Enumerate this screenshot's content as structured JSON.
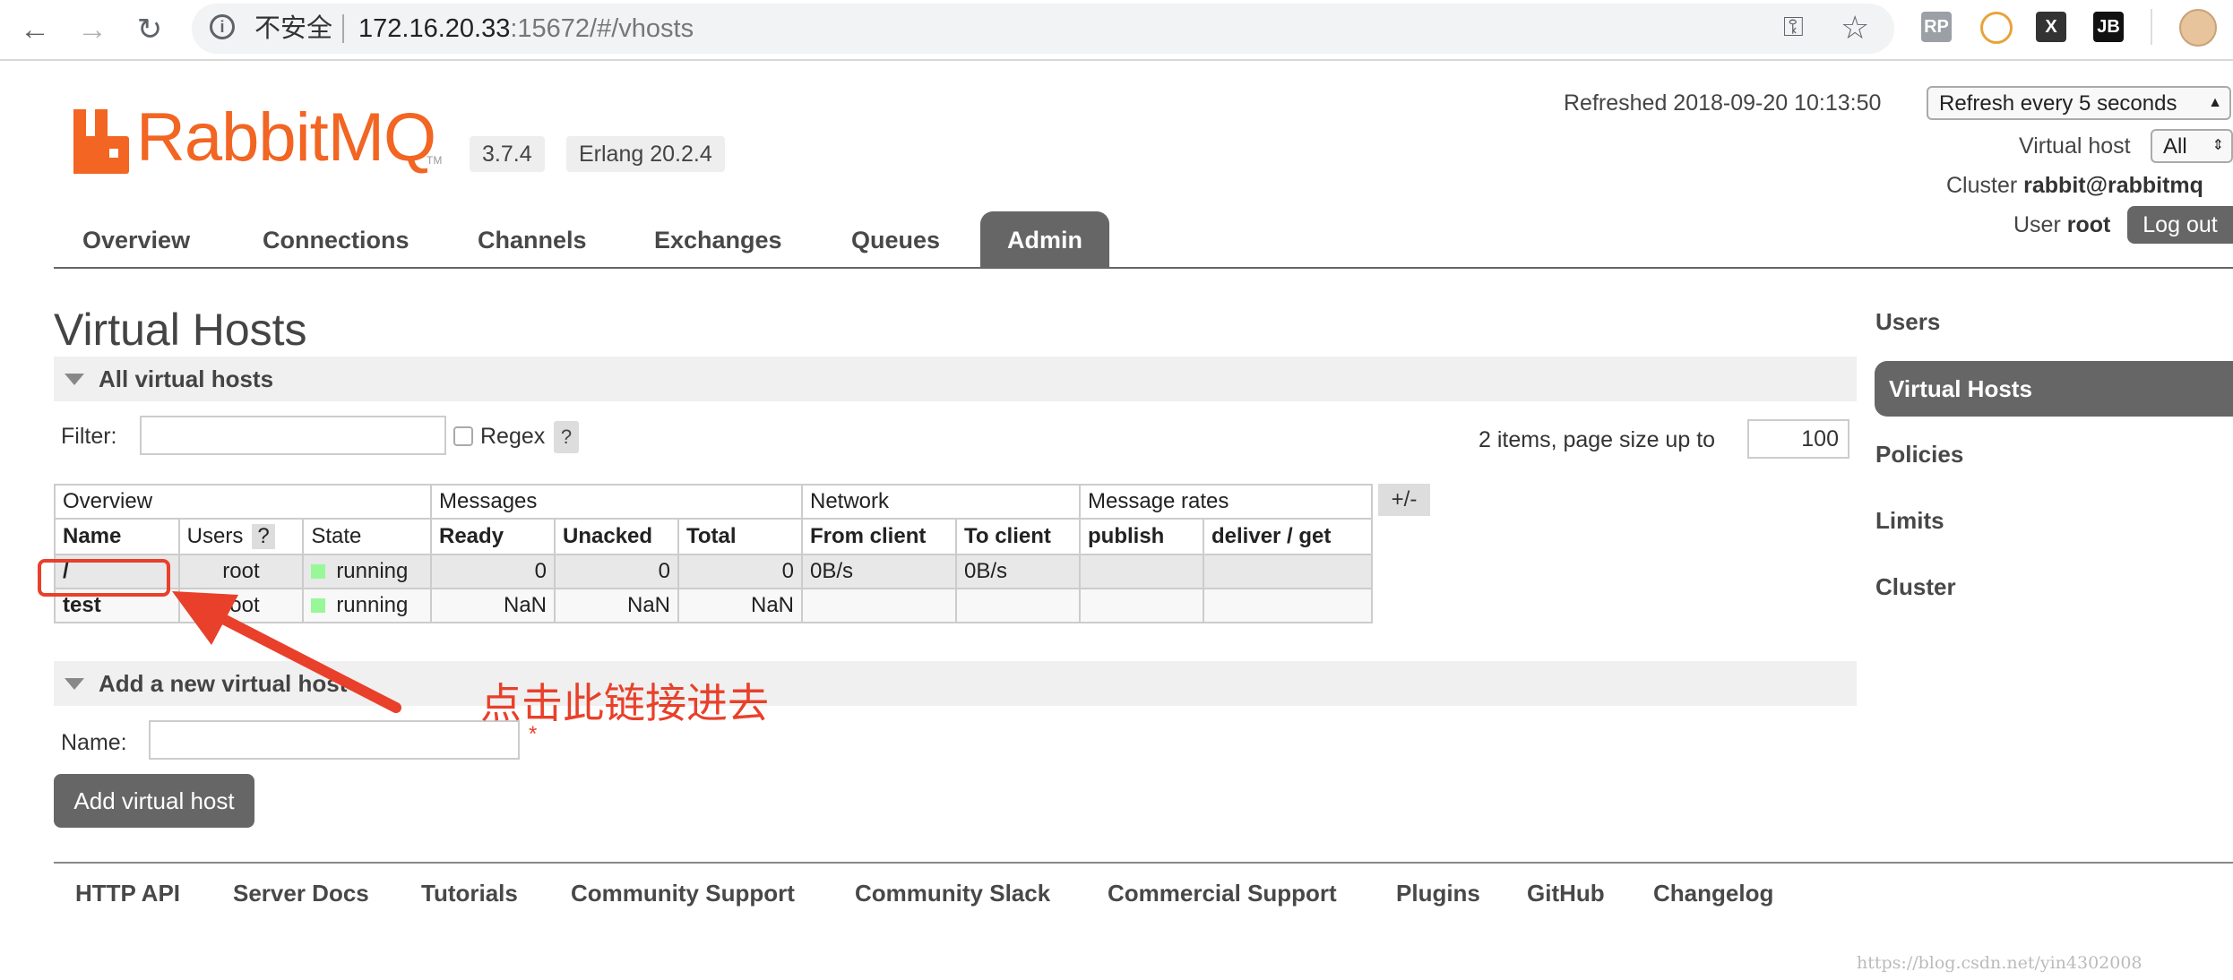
{
  "browser": {
    "security_label": "不安全",
    "url_host": "172.16.20.33",
    "url_rest": ":15672/#/vhosts",
    "extensions": [
      {
        "name": "rp-extension",
        "label": "RP",
        "color": "#9aa0a6"
      },
      {
        "name": "color-wheel-extension",
        "label": "",
        "color": "#e8a33b"
      },
      {
        "name": "x-extension",
        "label": "X",
        "color": "#333333"
      },
      {
        "name": "jb-extension",
        "label": "JB",
        "color": "#111111"
      }
    ]
  },
  "header": {
    "logo_text": "RabbitMQ",
    "logo_tm": "TM",
    "version": "3.7.4",
    "erlang": "Erlang 20.2.4",
    "refreshed_label": "Refreshed 2018-09-20 10:13:50",
    "refresh_select": "Refresh every 5 seconds",
    "vhost_label": "Virtual host",
    "vhost_select": "All",
    "cluster_label": "Cluster",
    "cluster_name": "rabbit@rabbitmq",
    "user_label": "User",
    "user_name": "root",
    "logout_label": "Log out"
  },
  "tabs": [
    "Overview",
    "Connections",
    "Channels",
    "Exchanges",
    "Queues",
    "Admin"
  ],
  "sidebar": [
    "Users",
    "Virtual Hosts",
    "Policies",
    "Limits",
    "Cluster"
  ],
  "main": {
    "title": "Virtual Hosts",
    "all_section": "All virtual hosts",
    "filter_label": "Filter:",
    "regex_label": "Regex",
    "help_q": "?",
    "items_label": "2 items, page size up to",
    "page_size": "100",
    "plus_minus": "+/-",
    "groups": [
      "Overview",
      "Messages",
      "Network",
      "Message rates"
    ],
    "columns": [
      "Name",
      "Users",
      "State",
      "Ready",
      "Unacked",
      "Total",
      "From client",
      "To client",
      "publish",
      "deliver / get"
    ],
    "rows": [
      {
        "name": "/",
        "users": "root",
        "state": "running",
        "ready": "0",
        "unacked": "0",
        "total": "0",
        "from_client": "0B/s",
        "to_client": "0B/s",
        "publish": "",
        "deliver_get": ""
      },
      {
        "name": "test",
        "users": "root",
        "state": "running",
        "ready": "NaN",
        "unacked": "NaN",
        "total": "NaN",
        "from_client": "",
        "to_client": "",
        "publish": "",
        "deliver_get": ""
      }
    ],
    "add_section": "Add a new virtual host",
    "name_label": "Name:",
    "required_mark": "*",
    "add_button": "Add virtual host"
  },
  "footer": [
    "HTTP API",
    "Server Docs",
    "Tutorials",
    "Community Support",
    "Community Slack",
    "Commercial Support",
    "Plugins",
    "GitHub",
    "Changelog"
  ],
  "annotation": {
    "text": "点击此链接进去",
    "color": "#e8402a"
  },
  "watermark": "https://blog.csdn.net/yin4302008"
}
